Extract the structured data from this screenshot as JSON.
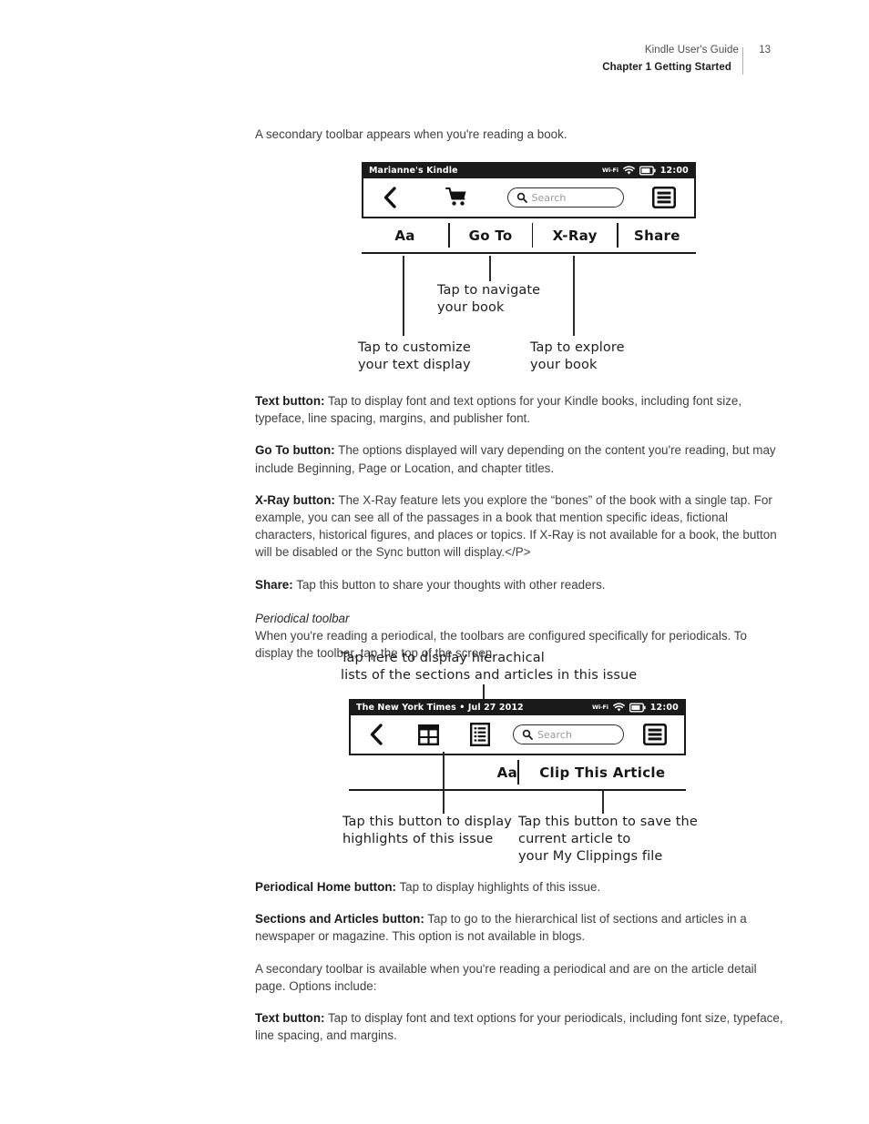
{
  "header": {
    "guide_title": "Kindle User's Guide",
    "page_number": "13",
    "chapter": "Chapter 1 Getting Started",
    "rule_color": "#f5a623"
  },
  "intro": {
    "line": "A secondary toolbar appears when you're reading a book."
  },
  "book_toolbar": {
    "status": {
      "device_name": "Marianne's Kindle",
      "wifi_label": "Wi-Fi",
      "clock": "12:00"
    },
    "icons": {
      "back": "back-chevron-icon",
      "store": "shopping-cart-icon",
      "menu": "menu-icon"
    },
    "search_placeholder": "Search",
    "secondary_items": [
      "Aa",
      "Go To",
      "X-Ray",
      "Share"
    ],
    "callouts": {
      "text": "Tap to customize\nyour text display",
      "goto": "Tap to navigate\nyour book",
      "xray": "Tap to explore\nyour book"
    }
  },
  "periodical_toolbar": {
    "top_callout": "Tap here to display hierachical\nlists of the sections and articles in this issue",
    "status": {
      "device_name": "The New York Times • Jul 27 2012",
      "wifi_label": "Wi-Fi",
      "clock": "12:00"
    },
    "icons": {
      "back": "back-chevron-icon",
      "home": "periodical-home-grid-icon",
      "sections": "sections-articles-list-icon",
      "menu": "menu-icon"
    },
    "search_placeholder": "Search",
    "secondary_items": [
      "Aa",
      "Clip This Article"
    ],
    "callouts": {
      "home": "Tap this button to display\nhighlights of this issue",
      "clip": "Tap this button to save the\ncurrent article to\nyour My Clippings file"
    }
  },
  "paragraphs": {
    "text_button_label": "Text button:",
    "text_button_body": " Tap to display font and text options for your Kindle books, including font size, typeface, line spacing, margins, and publisher font.",
    "goto_button_label": "Go To button:",
    "goto_button_body": " The options displayed will vary depending on the content you're reading, but may include Beginning, Page or Location, and chapter titles.",
    "xray_button_label": "X-Ray button:",
    "xray_button_body": " The X-Ray feature lets you explore the “bones” of the book with a single tap. For example, you can see all of the passages in a book that mention specific ideas, fictional characters, historical figures, and places or topics. If X-Ray is not available for a book, the button will be disabled or the Sync button will display.</P>",
    "share_label": "Share:",
    "share_body": " Tap this button to share your thoughts with other readers.",
    "periodical_subhead": "Periodical toolbar",
    "periodical_intro": "When you're reading a periodical, the toolbars are configured specifically for periodicals. To display the toolbar, tap the top of the screen.",
    "periodical_home_label": "Periodical Home button:",
    "periodical_home_body": " Tap to display highlights of this issue.",
    "sections_label": "Sections and Articles button:",
    "sections_body": " Tap to go to the hierarchical list of sections and articles in a newspaper or magazine. This option is not available in blogs.",
    "secondary_periodical": "A secondary toolbar is available when you're reading a periodical and are on the article detail page. Options include:",
    "text_button2_label": "Text button:",
    "text_button2_body": " Tap to display font and text options for your periodicals, including font size, typeface, line spacing, and margins."
  }
}
